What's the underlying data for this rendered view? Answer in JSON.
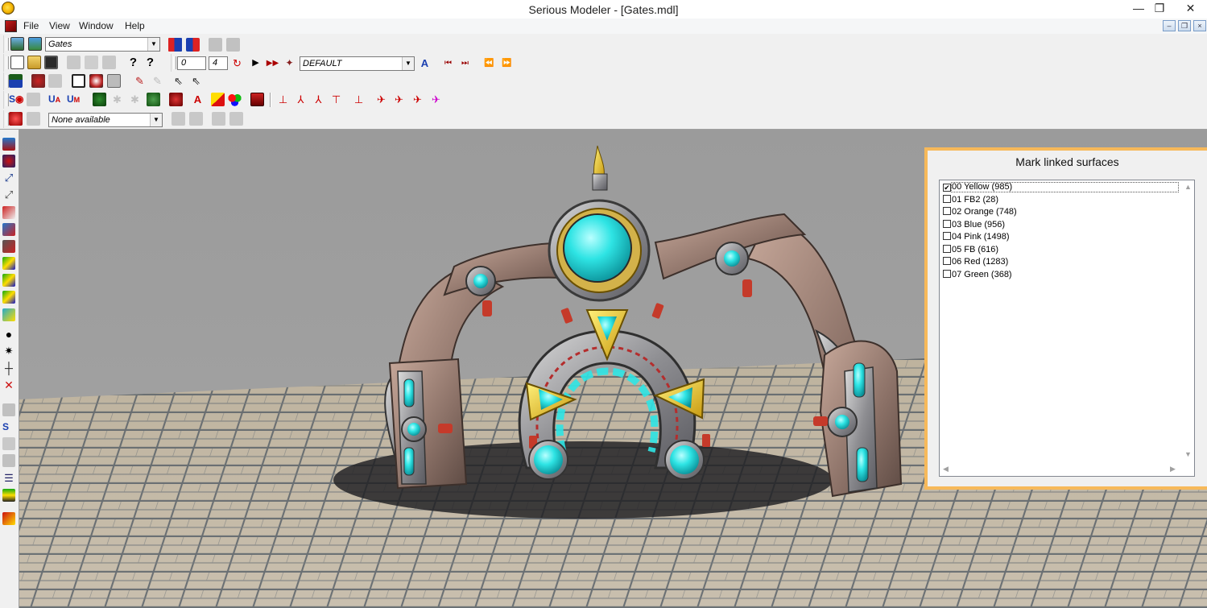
{
  "window": {
    "title": "Serious Modeler - [Gates.mdl]",
    "controls": {
      "minimize": "—",
      "maximize": "❐",
      "close": "✕"
    }
  },
  "menu": {
    "items": [
      {
        "label": "File"
      },
      {
        "label": "View"
      },
      {
        "label": "Window"
      },
      {
        "label": "Help"
      }
    ],
    "mdi": {
      "minimize": "–",
      "restore": "❐",
      "close": "×"
    }
  },
  "toolbar": {
    "model_combo": "Gates",
    "frame_start": "0",
    "frame_end": "4",
    "animation_combo": "DEFAULT",
    "attachment_combo": "None available"
  },
  "panel": {
    "title": "Mark linked surfaces",
    "surfaces": [
      {
        "label": "00 Yellow (985)",
        "checked": true
      },
      {
        "label": "01 FB2 (28)",
        "checked": false
      },
      {
        "label": "02 Orange (748)",
        "checked": false
      },
      {
        "label": "03 Blue (956)",
        "checked": false
      },
      {
        "label": "04 Pink (1498)",
        "checked": false
      },
      {
        "label": "05 FB (616)",
        "checked": false
      },
      {
        "label": "06 Red (1283)",
        "checked": false
      },
      {
        "label": "07 Green (368)",
        "checked": false
      }
    ]
  },
  "colors": {
    "panel_border": "#f7b95a",
    "sky": "#9a9a9a",
    "floor": "#b9ad98",
    "gem": "#2ee0e0",
    "gold": "#e8c22a",
    "metal": "#8d8d90",
    "stone": "#8a7a70"
  }
}
